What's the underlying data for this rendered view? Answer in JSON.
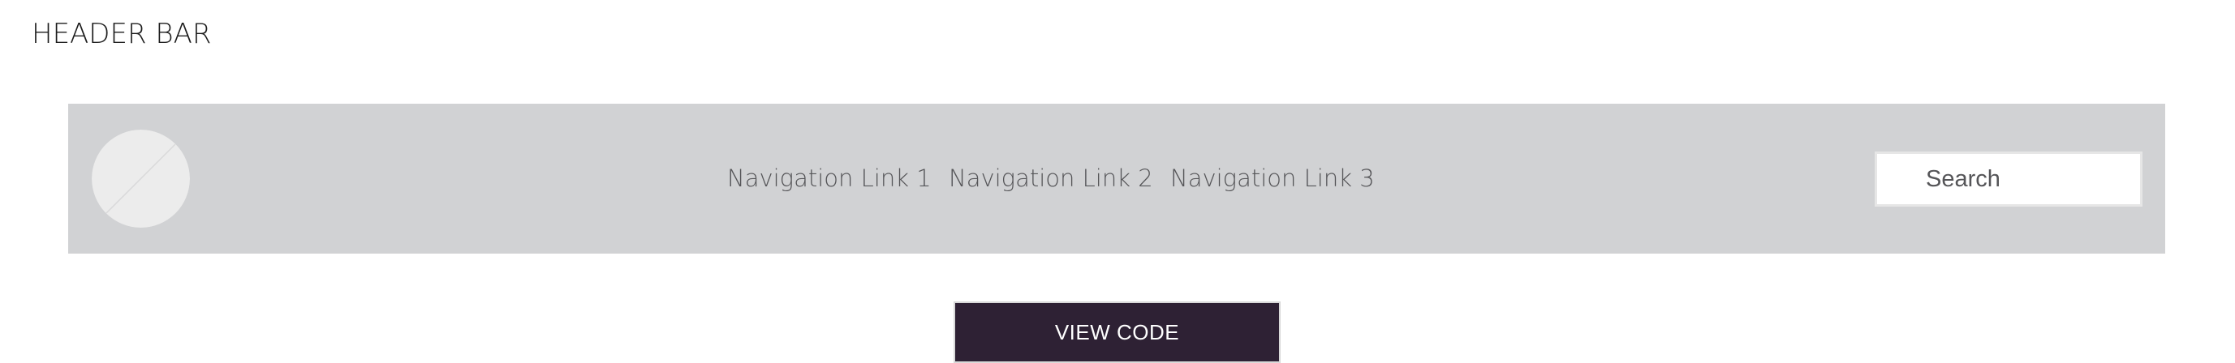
{
  "page": {
    "title": "HEADER BAR"
  },
  "header_bar": {
    "background_color": "#d1d2d4",
    "logo": {
      "icon": "placeholder-logo-circle",
      "fill_color": "#ececec",
      "stroke_color": "#d1d2d4"
    },
    "nav_links": [
      {
        "label": "Navigation Link 1"
      },
      {
        "label": "Navigation Link 2"
      },
      {
        "label": "Navigation Link 3"
      }
    ],
    "search": {
      "placeholder": "Search",
      "value": ""
    }
  },
  "actions": {
    "view_code_label": "VIEW CODE",
    "view_code_color": "#2e2134"
  }
}
